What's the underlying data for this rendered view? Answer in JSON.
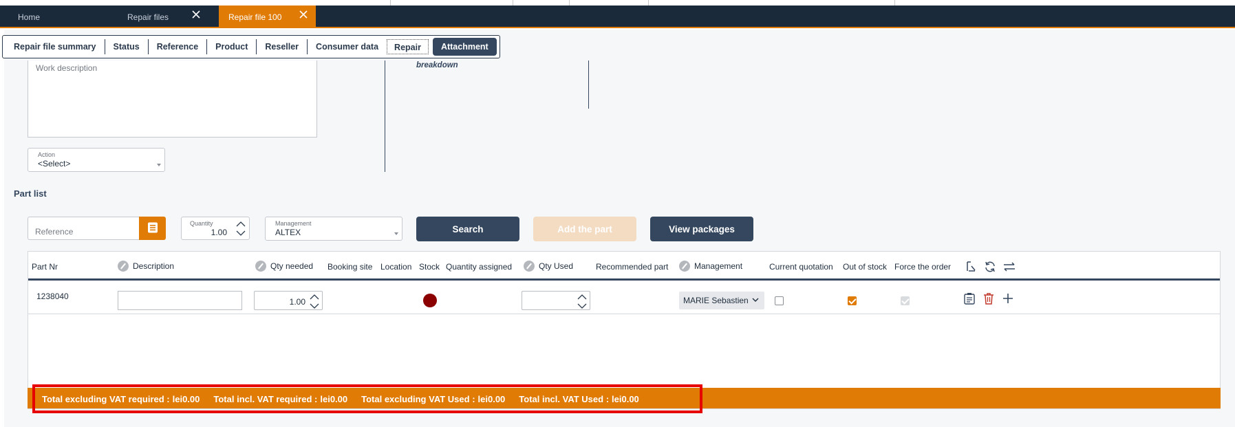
{
  "tabs": [
    {
      "label": "Home",
      "closable": false,
      "active": false
    },
    {
      "label": "Repair files",
      "closable": true,
      "active": false
    },
    {
      "label": "Repair file 100",
      "closable": true,
      "active": true
    }
  ],
  "subtabs": [
    "Repair file summary",
    "Status",
    "Reference",
    "Product",
    "Reseller",
    "Consumer data",
    "Repair",
    "Attachment"
  ],
  "subtabs_active": "Attachment",
  "form": {
    "work_description_placeholder": "Work description",
    "breakdown_label": "breakdown",
    "action_label": "Action",
    "action_value": "<Select>"
  },
  "part_list": {
    "title": "Part list",
    "reference_placeholder": "Reference",
    "quantity_label": "Quantity",
    "quantity_value": "1.00",
    "management_label": "Management",
    "management_value": "ALTEX",
    "search_button": "Search",
    "add_part_button": "Add the part",
    "view_packages_button": "View packages"
  },
  "grid": {
    "headers": {
      "part_nr": "Part Nr",
      "description": "Description",
      "qty_needed": "Qty needed",
      "booking_site": "Booking site",
      "location": "Location",
      "stock": "Stock",
      "quantity_assigned": "Quantity assigned",
      "qty_used": "Qty Used",
      "recommended_part": "Recommended part",
      "management": "Management",
      "current_quotation": "Current quotation",
      "out_of_stock": "Out of stock",
      "force_the_order": "Force the order"
    },
    "rows": [
      {
        "part_nr": "1238040",
        "description": "",
        "qty_needed": "1.00",
        "qty_used": "",
        "stock_status_color": "#8b0000",
        "management": "MARIE Sebastien",
        "current_quotation": false,
        "out_of_stock": true,
        "force_the_order": true
      }
    ]
  },
  "totals": {
    "excl_vat_required_label": "Total excluding VAT required :",
    "excl_vat_required_value": "lei0.00",
    "incl_vat_required_label": "Total incl. VAT required :",
    "incl_vat_required_value": "lei0.00",
    "excl_vat_used_label": "Total excluding VAT Used :",
    "excl_vat_used_value": "lei0.00",
    "incl_vat_used_label": "Total incl. VAT Used :",
    "incl_vat_used_value": "lei0.00"
  },
  "icons": [
    "close-icon",
    "list-icon",
    "chevron-up-icon",
    "chevron-down-icon",
    "edit-icon",
    "reset-icon",
    "refresh-icon",
    "swap-icon",
    "clipboard-icon",
    "trash-icon",
    "plus-icon"
  ],
  "colors": {
    "navbar": "#1b2a3b",
    "accent": "#e07b06",
    "primary_button": "#34475f",
    "disabled_button": "#f4dcc3",
    "highlight_box": "#e60000",
    "stock_dot": "#8b0000",
    "trash": "#c0392b"
  }
}
